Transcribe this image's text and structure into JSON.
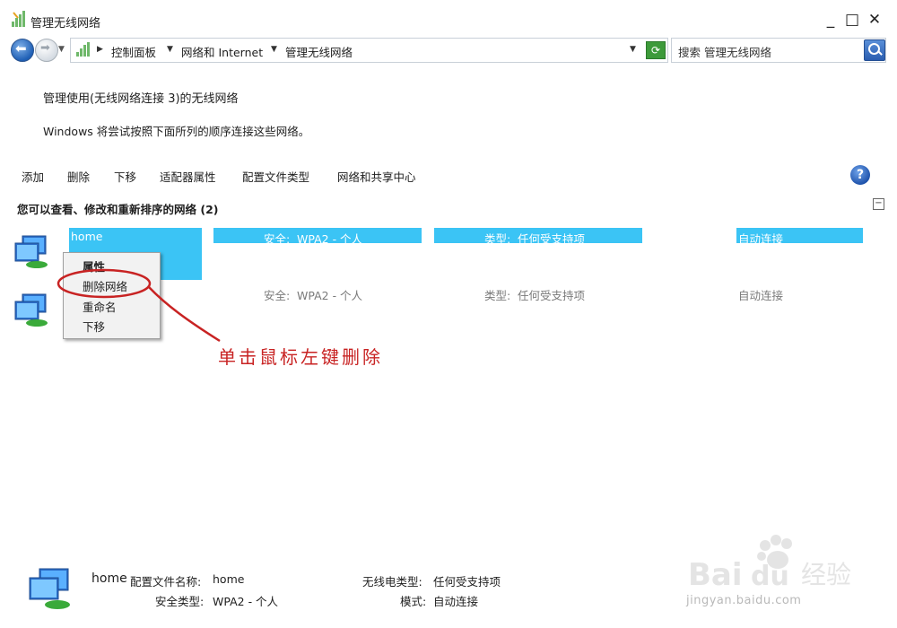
{
  "window": {
    "title": "管理无线网络",
    "minimize": "_",
    "maximize": "□",
    "close": "✕"
  },
  "address": {
    "crumbs": [
      "控制面板",
      "网络和 Internet",
      "管理无线网络"
    ],
    "search_placeholder": "搜索 管理无线网络"
  },
  "content": {
    "heading": "管理使用(无线网络连接 3)的无线网络",
    "subtext": "Windows 将尝试按照下面所列的顺序连接这些网络。"
  },
  "toolbar": {
    "add": "添加",
    "remove": "删除",
    "move_down": "下移",
    "adapter_properties": "适配器属性",
    "profile_types": "配置文件类型",
    "network_center": "网络和共享中心",
    "help": "?"
  },
  "group": {
    "title": "您可以查看、修改和重新排序的网络 (2)",
    "collapse": "−"
  },
  "networks": [
    {
      "name": "home",
      "security_label": "安全:",
      "security_value": "WPA2 - 个人",
      "type_label": "类型:",
      "type_value": "任何受支持项",
      "mode": "自动连接"
    },
    {
      "name": "",
      "security_label": "安全:",
      "security_value": "WPA2 - 个人",
      "type_label": "类型:",
      "type_value": "任何受支持项",
      "mode": "自动连接"
    }
  ],
  "context_menu": {
    "properties": "属性",
    "delete_network": "删除网络",
    "rename": "重命名",
    "move_down": "下移"
  },
  "annotation": {
    "text": "单击鼠标左键删除",
    "color": "#c82323"
  },
  "details": {
    "name": "home",
    "profile_name_label": "配置文件名称:",
    "profile_name_value": "home",
    "radio_type_label": "无线电类型:",
    "radio_type_value": "任何受支持项",
    "security_type_label": "安全类型:",
    "security_type_value": "WPA2 - 个人",
    "mode_label": "模式:",
    "mode_value": "自动连接"
  },
  "watermark": {
    "brand": "Bai du 经验",
    "url": "jingyan.baidu.com"
  },
  "colors": {
    "selection": "#3bc4f5",
    "annotation": "#c82323"
  }
}
